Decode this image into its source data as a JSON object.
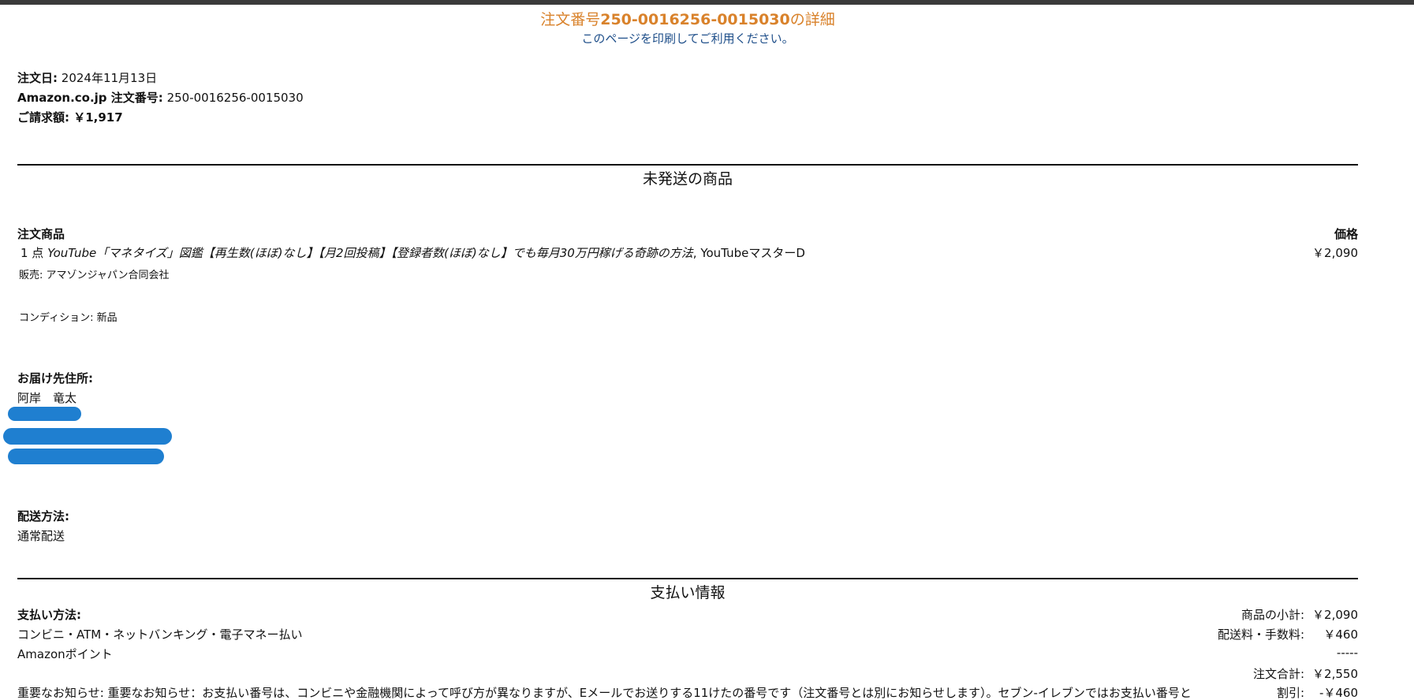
{
  "header": {
    "title_prefix": "注文番号",
    "title_number": "250-0016256-0015030",
    "title_suffix": "の詳細",
    "print_note": "このページを印刷してご利用ください。"
  },
  "summary": {
    "order_date_label": "注文日:",
    "order_date": "2024年11月13日",
    "order_no_label": "Amazon.co.jp 注文番号:",
    "order_no": "250-0016256-0015030",
    "billing_label": "ご請求額:",
    "billing_amount": "￥1,917"
  },
  "unshipped": {
    "heading": "未発送の商品",
    "items_label": "注文商品",
    "price_label": "価格",
    "item_qty": "1 点",
    "item_title": "YouTube「マネタイズ」図鑑【再生数(ほぼ)なし】【月2回投稿】【登録者数(ほぼ)なし】でも毎月30万円稼げる奇跡の方法",
    "item_author": ", YouTubeマスターD",
    "item_price": "￥2,090",
    "seller": "販売: アマゾンジャパン合同会社",
    "condition": "コンディション: 新品"
  },
  "shipping": {
    "address_label": "お届け先住所:",
    "recipient": "阿岸　竜太",
    "method_label": "配送方法:",
    "method": "通常配送"
  },
  "payment": {
    "heading": "支払い情報",
    "method_label": "支払い方法:",
    "method_1": "コンビニ・ATM・ネットバンキング・電子マネー払い",
    "method_2": "Amazonポイント",
    "notice": "重要なお知らせ: 重要なお知らせ：お支払い番号は、コンビニや金融機関によって呼び方が異なりますが、Eメールでお送りする11けたの番号です（注文番号とは別にお知らせします）。セブン-イレブンではお支払い番号とは別",
    "subtotal_label": "商品の小計:",
    "subtotal": "￥2,090",
    "shipping_fee_label": "配送料・手数料:",
    "shipping_fee": "￥460",
    "separator": "-----",
    "order_total_label": "注文合計:",
    "order_total": "￥2,550",
    "discount_label": "割引:",
    "discount": "-￥460"
  },
  "colors": {
    "title": "#d9822b",
    "subtitle": "#1f4f8a",
    "redaction": "#1f7fd0"
  }
}
